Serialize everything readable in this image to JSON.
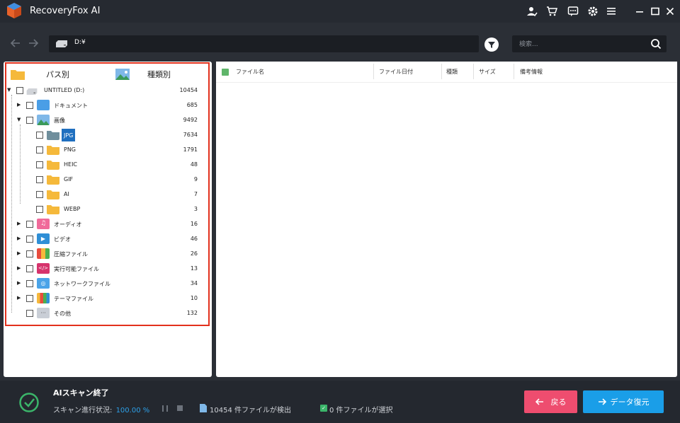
{
  "app": {
    "title": "RecoveryFox AI"
  },
  "toolbar": {
    "path": "D:¥",
    "search_placeholder": "検索..."
  },
  "left_panel": {
    "tabs": [
      {
        "label": "パス別"
      },
      {
        "label": "種類別"
      }
    ],
    "tree": [
      {
        "label": "UNTITLED (D:)",
        "count": "10454"
      },
      {
        "label": "ドキュメント",
        "count": "685"
      },
      {
        "label": "画像",
        "count": "9492"
      },
      {
        "label": "JPG",
        "count": "7634"
      },
      {
        "label": "PNG",
        "count": "1791"
      },
      {
        "label": "HEIC",
        "count": "48"
      },
      {
        "label": "GIF",
        "count": "9"
      },
      {
        "label": "AI",
        "count": "7"
      },
      {
        "label": "WEBP",
        "count": "3"
      },
      {
        "label": "オーディオ",
        "count": "16"
      },
      {
        "label": "ビデオ",
        "count": "46"
      },
      {
        "label": "圧縮ファイル",
        "count": "26"
      },
      {
        "label": "実行可能ファイル",
        "count": "13"
      },
      {
        "label": "ネットワークファイル",
        "count": "34"
      },
      {
        "label": "テーマファイル",
        "count": "10"
      },
      {
        "label": "その他",
        "count": "132"
      }
    ]
  },
  "file_list": {
    "columns": [
      "ファイル名",
      "ファイル日付",
      "種類",
      "サイズ",
      "備考情報"
    ]
  },
  "status": {
    "title": "AIスキャン終了",
    "progress_label": "スキャン進行状況:",
    "progress_value": "100.00 %",
    "found_text": "10454 件ファイルが検出",
    "selected_text": "0 件ファイルが選択",
    "back_button": "戻る",
    "recover_button": "データ復元"
  },
  "colors": {
    "accent_red": "#e2311d",
    "back_button": "#ee4d6f",
    "recover_button": "#1a9ee8",
    "progress_value": "#2da0e8",
    "check_green": "#3bb56a"
  }
}
